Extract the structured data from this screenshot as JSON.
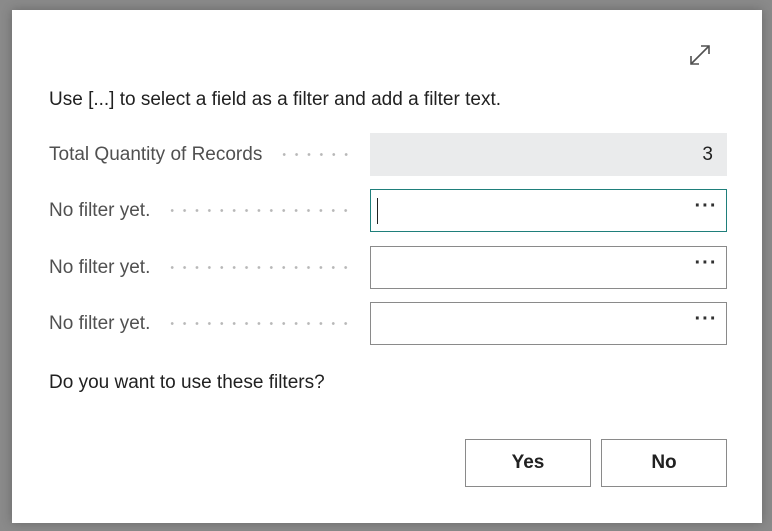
{
  "dialog": {
    "instruction": "Use [...] to select a field as a filter and add a filter text.",
    "question": "Do you want to use these filters?",
    "expand_icon": "expand-icon",
    "rows": [
      {
        "label": "Total Quantity of Records",
        "value": "3",
        "readonly": true
      },
      {
        "label": "No filter yet.",
        "value": "",
        "readonly": false,
        "focused": true
      },
      {
        "label": "No filter yet.",
        "value": "",
        "readonly": false,
        "focused": false
      },
      {
        "label": "No filter yet.",
        "value": "",
        "readonly": false,
        "focused": false
      }
    ],
    "lookup_label": "···",
    "buttons": {
      "yes_label": "Yes",
      "no_label": "No"
    }
  },
  "colors": {
    "focus_border": "#1f7f7b",
    "readonly_bg": "#eaebec",
    "label_text": "#505050"
  }
}
